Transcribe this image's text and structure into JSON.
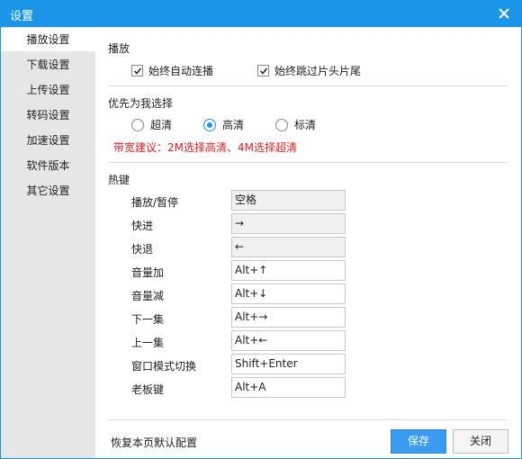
{
  "window": {
    "title": "设置"
  },
  "sidebar": {
    "items": [
      {
        "label": "播放设置",
        "active": true
      },
      {
        "label": "下载设置"
      },
      {
        "label": "上传设置"
      },
      {
        "label": "转码设置"
      },
      {
        "label": "加速设置"
      },
      {
        "label": "软件版本"
      },
      {
        "label": "其它设置"
      }
    ]
  },
  "playback": {
    "title": "播放",
    "auto_play_label": "始终自动连播",
    "auto_play_checked": true,
    "skip_intro_label": "始终跳过片头片尾",
    "skip_intro_checked": true
  },
  "quality": {
    "title": "优先为我选择",
    "options": [
      {
        "label": "超清",
        "selected": false
      },
      {
        "label": "高清",
        "selected": true
      },
      {
        "label": "标清",
        "selected": false
      }
    ],
    "hint": "带宽建议：2M选择高清、4M选择超清"
  },
  "hotkeys": {
    "title": "热键",
    "rows": [
      {
        "label": "播放/暂停",
        "value": "空格",
        "disabled": true
      },
      {
        "label": "快进",
        "value": "→",
        "disabled": true
      },
      {
        "label": "快退",
        "value": "←",
        "disabled": true
      },
      {
        "label": "音量加",
        "value": "Alt+↑"
      },
      {
        "label": "音量减",
        "value": "Alt+↓"
      },
      {
        "label": "下一集",
        "value": "Alt+→"
      },
      {
        "label": "上一集",
        "value": "Alt+←"
      },
      {
        "label": "窗口模式切换",
        "value": "Shift+Enter"
      },
      {
        "label": "老板键",
        "value": "Alt+A"
      }
    ]
  },
  "footer": {
    "restore_label": "恢复本页默认配置",
    "save_label": "保存",
    "close_label": "关闭"
  },
  "colors": {
    "accent": "#1a95e8",
    "hint": "#e02020",
    "sidebar_bg": "#e6e6e6"
  }
}
